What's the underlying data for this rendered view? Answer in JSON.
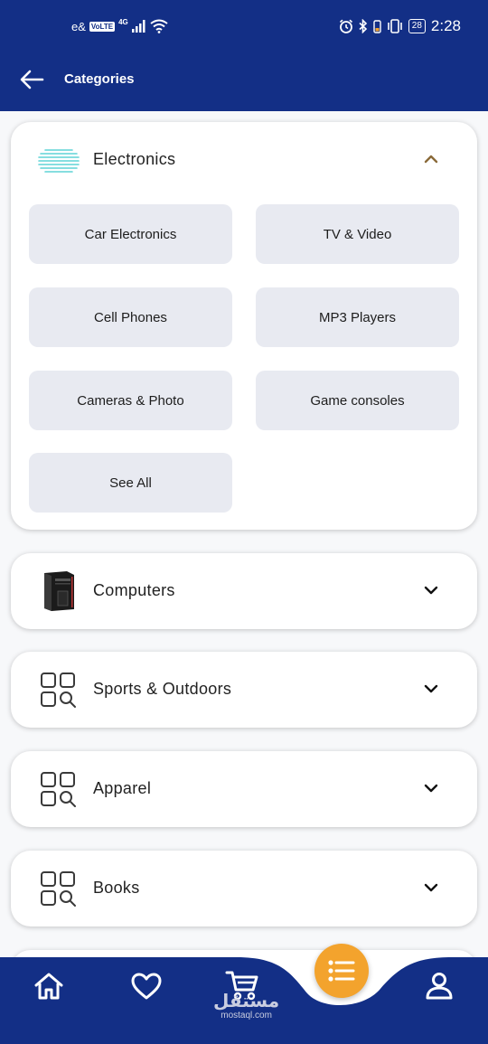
{
  "status_bar": {
    "carrier": "e&",
    "volte": "VoLTE",
    "network": "4G",
    "battery": "28",
    "time": "2:28"
  },
  "header": {
    "title": "Categories"
  },
  "categories": [
    {
      "name": "Electronics",
      "expanded": true,
      "subcategories": [
        "Car Electronics",
        "TV & Video",
        "Cell Phones",
        "MP3 Players",
        "Cameras & Photo",
        "Game consoles",
        "See All"
      ]
    },
    {
      "name": "Computers",
      "expanded": false
    },
    {
      "name": "Sports & Outdoors",
      "expanded": false
    },
    {
      "name": "Apparel",
      "expanded": false
    },
    {
      "name": "Books",
      "expanded": false
    }
  ],
  "bottom_nav": {
    "items": [
      "home-icon",
      "heart-icon",
      "cart-icon",
      "menu-list-icon",
      "profile-icon"
    ],
    "active": "menu-list-icon"
  },
  "watermark": {
    "arabic": "مستقل",
    "latin": "mostaql.com"
  },
  "colors": {
    "primary": "#132f86",
    "accent": "#f3a32d",
    "chip_bg": "#e8eaf1",
    "chevron_expanded": "#8a6a3a"
  }
}
